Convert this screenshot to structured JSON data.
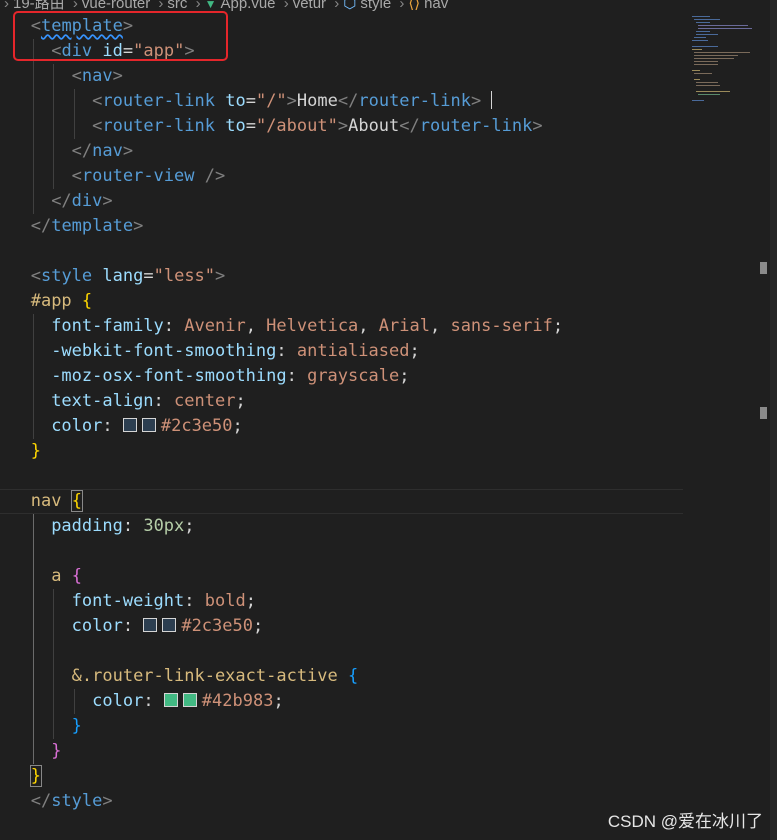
{
  "breadcrumb": {
    "items": [
      "19-路由",
      "vue-router",
      "src",
      "App.vue",
      "vetur",
      "style",
      "nav"
    ],
    "icons": {
      "App.vue": "vue-logo-icon",
      "style": "cube-icon",
      "nav": "tag-icon"
    }
  },
  "code": {
    "template_open": "template",
    "div": "div",
    "id_attr": "id",
    "id_value": "\"app\"",
    "nav": "nav",
    "router_link": "router-link",
    "to_attr": "to",
    "link1_to": "\"/\"",
    "link1_text": "Home",
    "link2_to": "\"/about\"",
    "link2_text": "About",
    "router_view": "router-view",
    "template_close": "template",
    "style_tag": "style",
    "lang_attr": "lang",
    "lang_value": "\"less\"",
    "app_selector": "#app",
    "font_family_prop": "font-family",
    "font_family_value": "Avenir, Helvetica, Arial, sans-serif;",
    "webkit_prop": "-webkit-font-smoothing",
    "webkit_value": "antialiased",
    "moz_prop": "-moz-osx-font-smoothing",
    "moz_value": "grayscale",
    "text_align_prop": "text-align",
    "text_align_value": "center",
    "color_prop": "color",
    "color1_value": "#2c3e50",
    "nav_selector": "nav",
    "padding_prop": "padding",
    "padding_value": "30px",
    "a_selector": "a",
    "font_weight_prop": "font-weight",
    "font_weight_value": "bold",
    "color2_value": "#2c3e50",
    "exact_active_selector": "&.router-link-exact-active",
    "color3_value": "#42b983",
    "style_close": "style"
  },
  "colors": {
    "swatch_dark": "#2c3e50",
    "swatch_green": "#42b983",
    "highlight_border": "#e5262b"
  },
  "watermark": "CSDN @爱在冰川了"
}
